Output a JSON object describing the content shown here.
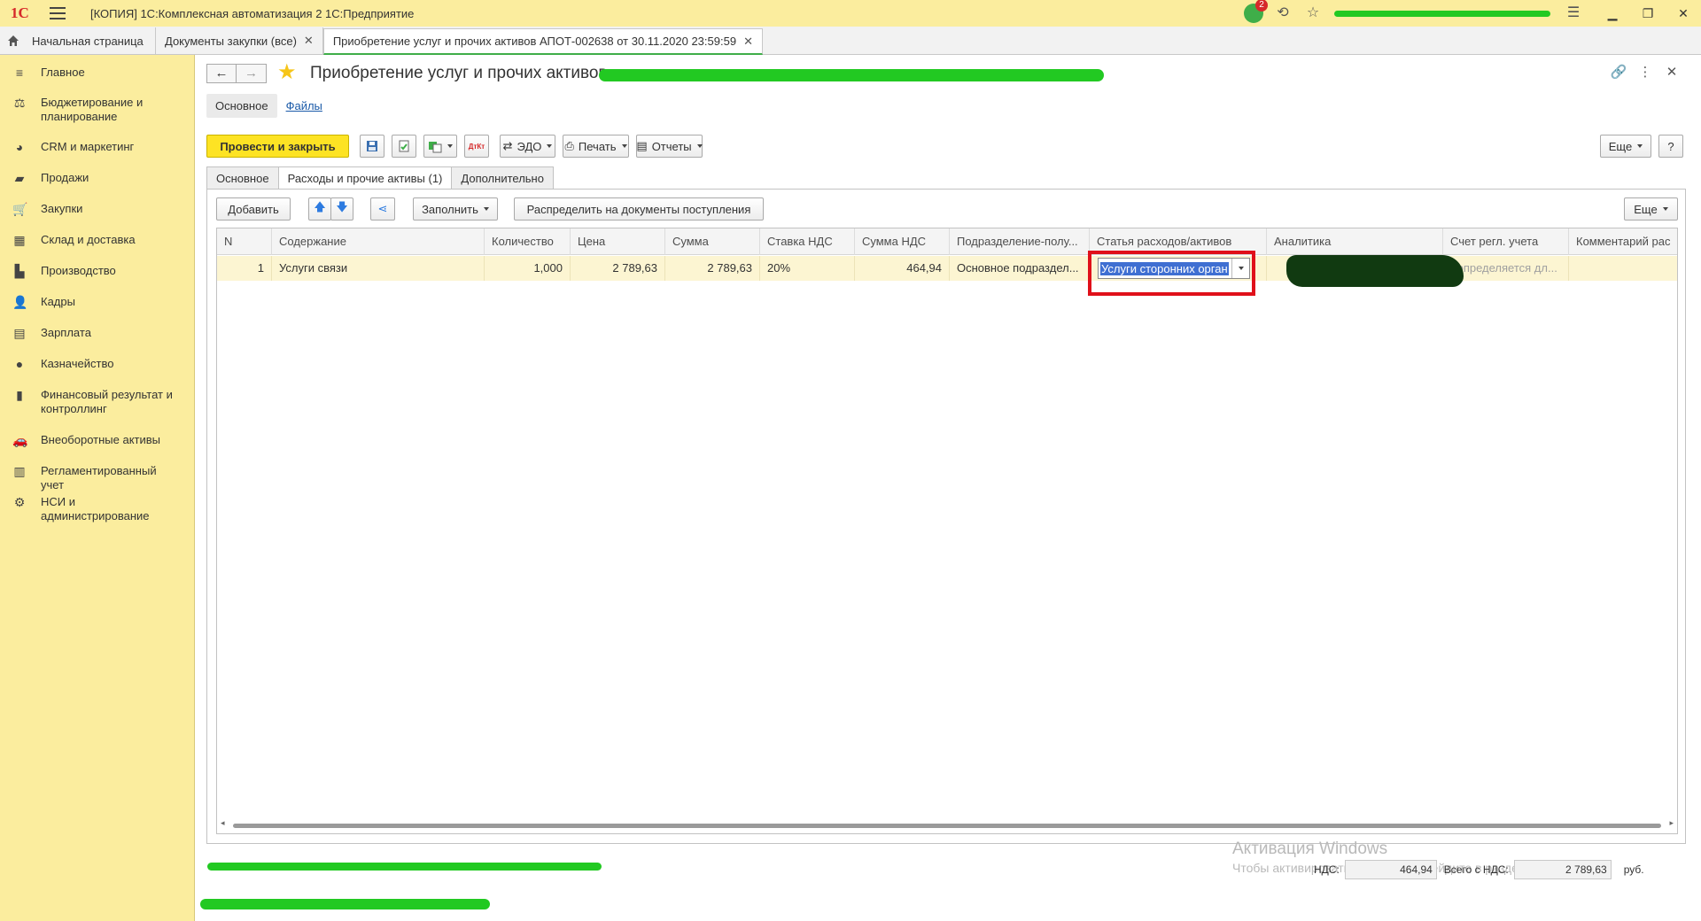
{
  "titlebar": {
    "logo": "1С",
    "title": "[КОПИЯ] 1С:Комплексная автоматизация 2 1С:Предприятие",
    "notifications_count": "2",
    "minimize": "▁",
    "maximize": "❐",
    "close": "✕"
  },
  "open_tabs": {
    "home": "Начальная страница",
    "tab1": "Документы закупки (все)",
    "tab2": "Приобретение услуг и прочих активов АПОТ-002638 от 30.11.2020 23:59:59"
  },
  "sidebar": {
    "items": [
      {
        "label": "Главное",
        "icon": "menu-icon"
      },
      {
        "label": "Бюджетирование и планирование",
        "icon": "budget-icon"
      },
      {
        "label": "CRM и маркетинг",
        "icon": "pie-icon"
      },
      {
        "label": "Продажи",
        "icon": "bag-icon"
      },
      {
        "label": "Закупки",
        "icon": "cart-icon"
      },
      {
        "label": "Склад и доставка",
        "icon": "warehouse-icon"
      },
      {
        "label": "Производство",
        "icon": "factory-icon"
      },
      {
        "label": "Кадры",
        "icon": "person-icon"
      },
      {
        "label": "Зарплата",
        "icon": "money-icon"
      },
      {
        "label": "Казначейство",
        "icon": "coin-icon"
      },
      {
        "label": "Финансовый результат и контроллинг",
        "icon": "chart-icon"
      },
      {
        "label": "Внеоборотные активы",
        "icon": "car-icon"
      },
      {
        "label": "Регламентированный учет",
        "icon": "ledger-icon"
      },
      {
        "label": "НСИ и администрирование",
        "icon": "gear-icon"
      }
    ]
  },
  "form": {
    "title": "Приобретение услуг и прочих активов",
    "subnav_main": "Основное",
    "subnav_files": "Файлы",
    "toolbar": {
      "post_close": "Провести и закрыть",
      "edo": "ЭДО",
      "print": "Печать",
      "reports": "Отчеты",
      "more": "Еще",
      "help": "?",
      "dt_kt": "ДтКт"
    },
    "tabs": [
      "Основное",
      "Расходы и прочие активы (1)",
      "Дополнительно"
    ],
    "table_toolbar": {
      "add": "Добавить",
      "fill": "Заполнить",
      "distribute": "Распределить на документы поступления",
      "more": "Еще"
    },
    "columns": [
      "N",
      "Содержание",
      "Количество",
      "Цена",
      "Сумма",
      "Ставка НДС",
      "Сумма НДС",
      "Подразделение-полу...",
      "Статья расходов/активов",
      "Аналитика",
      "Счет регл. учета",
      "Комментарий рас"
    ],
    "rows": [
      {
        "n": "1",
        "content": "Услуги связи",
        "qty": "1,000",
        "price": "2 789,63",
        "sum": "2 789,63",
        "vat_rate": "20%",
        "vat_sum": "464,94",
        "department": "Основное подраздел...",
        "expense_item": "Услуги сторонних орган",
        "account": "<определяется дл..."
      }
    ],
    "totals": {
      "vat_label": "НДС:",
      "vat_value": "464,94",
      "total_label": "Всего с НДС:",
      "total_value": "2 789,63",
      "currency": "руб."
    },
    "watermark": {
      "line1": "Активация Windows",
      "line2": "Чтобы активировать Windows, перейдите в раздел \"Параметры\"."
    }
  }
}
